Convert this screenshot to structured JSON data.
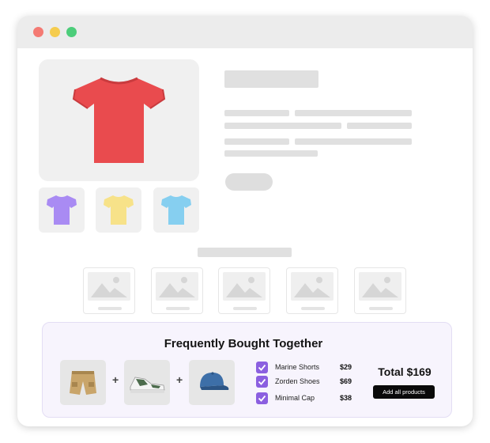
{
  "product": {
    "main_image": "red-tshirt",
    "color_variants": [
      {
        "icon": "purple-tshirt-icon",
        "color": "#a98bf3"
      },
      {
        "icon": "yellow-tshirt-icon",
        "color": "#f7e289"
      },
      {
        "icon": "blue-tshirt-icon",
        "color": "#86cff0"
      }
    ]
  },
  "fbt": {
    "title": "Frequently Bought Together",
    "items": [
      {
        "name": "Marine Shorts",
        "price": "$29",
        "checked": true
      },
      {
        "name": "Zorden Shoes",
        "price": "$69",
        "checked": true
      },
      {
        "name": "Minimal Cap",
        "price": "$38",
        "checked": true
      }
    ],
    "plus_sign": "+",
    "total": "Total $169",
    "add_all_label": "Add all products"
  },
  "colors": {
    "accent": "#8b5fe0",
    "main_shirt": "#e94b4e",
    "panel_bg": "#f7f4fd"
  }
}
